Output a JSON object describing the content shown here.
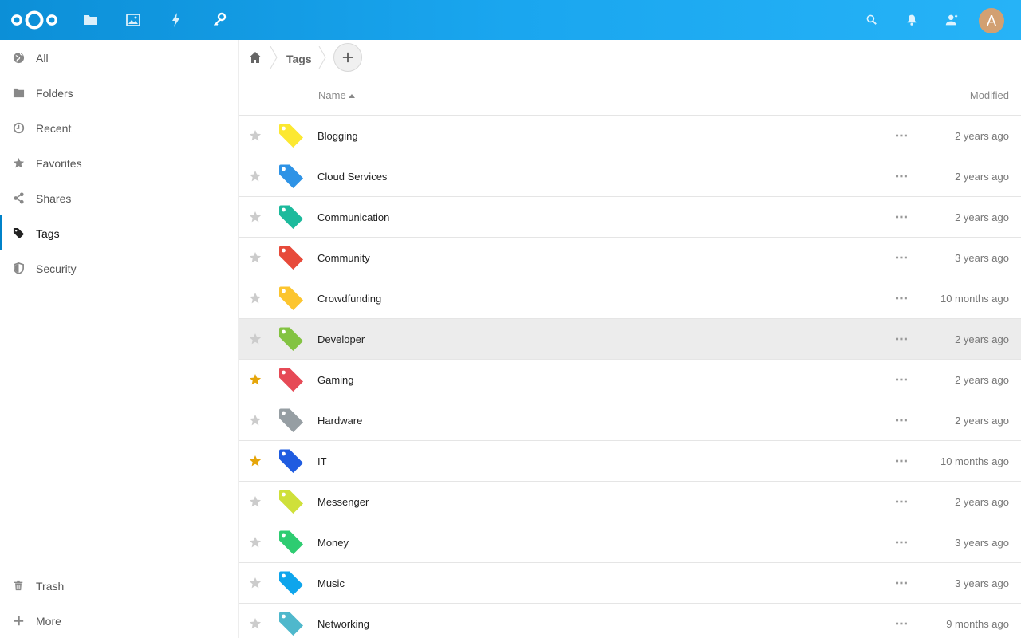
{
  "header": {
    "apps": [
      {
        "name": "files-app-icon",
        "icon": "folder-icon"
      },
      {
        "name": "photos-app-icon",
        "icon": "image-icon"
      },
      {
        "name": "activity-app-icon",
        "icon": "lightning-icon"
      },
      {
        "name": "passwords-app-icon",
        "icon": "key-icon"
      }
    ],
    "avatar_letter": "A",
    "avatar_color": "#d2a072"
  },
  "sidebar": {
    "items": [
      {
        "label": "All",
        "icon": "globe-icon"
      },
      {
        "label": "Folders",
        "icon": "folder-icon"
      },
      {
        "label": "Recent",
        "icon": "clock-icon"
      },
      {
        "label": "Favorites",
        "icon": "star-icon"
      },
      {
        "label": "Shares",
        "icon": "share-icon"
      },
      {
        "label": "Tags",
        "icon": "tag-icon",
        "active": true
      },
      {
        "label": "Security",
        "icon": "shield-icon"
      }
    ],
    "bottom": [
      {
        "label": "Trash",
        "icon": "trash-icon"
      },
      {
        "label": "More",
        "icon": "plus-icon"
      }
    ]
  },
  "breadcrumb": {
    "current": "Tags"
  },
  "columns": {
    "name": "Name",
    "modified": "Modified"
  },
  "rows": [
    {
      "name": "Blogging",
      "modified": "2 years ago",
      "color": "#fce831",
      "favorite": false
    },
    {
      "name": "Cloud Services",
      "modified": "2 years ago",
      "color": "#2e93e6",
      "favorite": false
    },
    {
      "name": "Communication",
      "modified": "2 years ago",
      "color": "#1cba9c",
      "favorite": false
    },
    {
      "name": "Community",
      "modified": "3 years ago",
      "color": "#e74a3a",
      "favorite": false
    },
    {
      "name": "Crowdfunding",
      "modified": "10 months ago",
      "color": "#fcc52f",
      "favorite": false
    },
    {
      "name": "Developer",
      "modified": "2 years ago",
      "color": "#83c342",
      "favorite": false,
      "highlighted": true
    },
    {
      "name": "Gaming",
      "modified": "2 years ago",
      "color": "#e64a56",
      "favorite": true
    },
    {
      "name": "Hardware",
      "modified": "2 years ago",
      "color": "#969ea3",
      "favorite": false
    },
    {
      "name": "IT",
      "modified": "10 months ago",
      "color": "#1f5ce0",
      "favorite": true
    },
    {
      "name": "Messenger",
      "modified": "2 years ago",
      "color": "#cfe03a",
      "favorite": false
    },
    {
      "name": "Money",
      "modified": "3 years ago",
      "color": "#2ecc71",
      "favorite": false
    },
    {
      "name": "Music",
      "modified": "3 years ago",
      "color": "#0ea5ec",
      "favorite": false
    },
    {
      "name": "Networking",
      "modified": "9 months ago",
      "color": "#4fb8cc",
      "favorite": false
    }
  ],
  "colors": {
    "header_gradient": [
      "#0c8fd7",
      "#26b3f7"
    ],
    "accent": "#0082c9",
    "favorite_star": "#e5a50a",
    "star_inactive": "#cccccc"
  }
}
